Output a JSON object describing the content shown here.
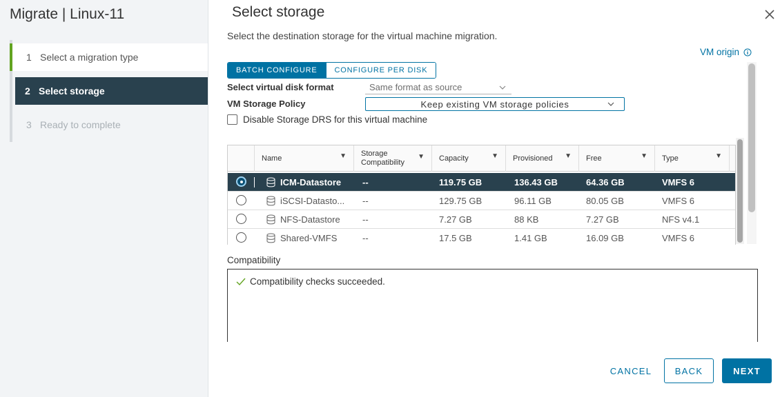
{
  "wizard": {
    "title": "Migrate | Linux-11",
    "steps": [
      {
        "num": "1",
        "label": "Select a migration type"
      },
      {
        "num": "2",
        "label": "Select storage"
      },
      {
        "num": "3",
        "label": "Ready to complete"
      }
    ]
  },
  "page": {
    "title": "Select storage",
    "description": "Select the destination storage for the virtual machine migration.",
    "vm_origin_link": "VM origin"
  },
  "mode_tabs": {
    "batch": "BATCH CONFIGURE",
    "per_disk": "CONFIGURE PER DISK"
  },
  "form": {
    "disk_format_label": "Select virtual disk format",
    "disk_format_value": "Same format as source",
    "policy_label": "VM Storage Policy",
    "policy_value": "Keep existing VM storage policies",
    "drs_checkbox_label": "Disable Storage DRS for this virtual machine",
    "drs_checked": false
  },
  "table": {
    "columns": [
      "Name",
      "Storage Compatibility",
      "Capacity",
      "Provisioned",
      "Free",
      "Type"
    ],
    "rows": [
      {
        "name": "ICM-Datastore",
        "compat": "--",
        "capacity": "119.75 GB",
        "provisioned": "136.43 GB",
        "free": "64.36 GB",
        "type": "VMFS 6",
        "selected": true
      },
      {
        "name": "iSCSI-Datasto...",
        "compat": "--",
        "capacity": "129.75 GB",
        "provisioned": "96.11 GB",
        "free": "80.05 GB",
        "type": "VMFS 6",
        "selected": false
      },
      {
        "name": "NFS-Datastore",
        "compat": "--",
        "capacity": "7.27 GB",
        "provisioned": "88 KB",
        "free": "7.27 GB",
        "type": "NFS v4.1",
        "selected": false
      },
      {
        "name": "Shared-VMFS",
        "compat": "--",
        "capacity": "17.5 GB",
        "provisioned": "1.41 GB",
        "free": "16.09 GB",
        "type": "VMFS 6",
        "selected": false
      }
    ]
  },
  "compatibility": {
    "label": "Compatibility",
    "message": "Compatibility checks succeeded."
  },
  "buttons": {
    "cancel": "CANCEL",
    "back": "BACK",
    "next": "NEXT"
  },
  "colors": {
    "accent": "#0072a3",
    "selected_row": "#29414e",
    "step_done": "#62a420",
    "success": "#62a420"
  }
}
